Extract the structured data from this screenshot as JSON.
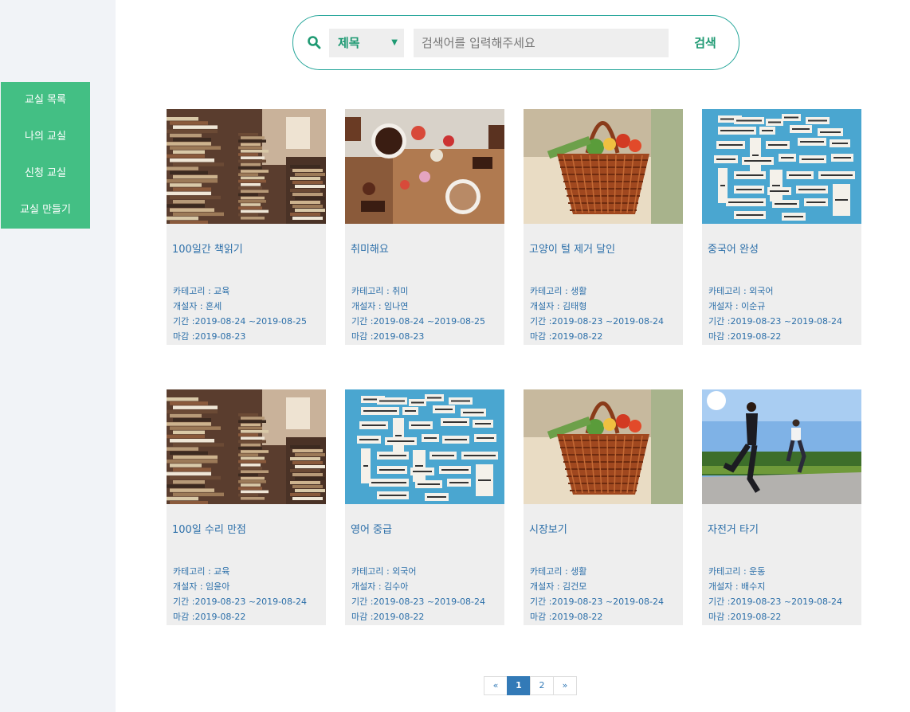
{
  "sidebar": {
    "items": [
      {
        "label": "교실 목록"
      },
      {
        "label": "나의 교실"
      },
      {
        "label": "신청 교실"
      },
      {
        "label": "교실 만들기"
      }
    ]
  },
  "search": {
    "select_value": "제목",
    "placeholder": "검색어를 입력해주세요",
    "button_label": "검색"
  },
  "cards": [
    {
      "title": "100일간 책읽기",
      "category": "카테고리 : 교육",
      "creator": "개설자 : 혼세",
      "period": "기간 :2019-08-24 ~2019-08-25",
      "deadline": "마감 :2019-08-23",
      "image": "books"
    },
    {
      "title": "취미해요",
      "category": "카테고리 : 취미",
      "creator": "개설자 : 임나연",
      "period": "기간 :2019-08-24 ~2019-08-25",
      "deadline": "마감 :2019-08-23",
      "image": "chocolate"
    },
    {
      "title": "고양이 털 제거 달인",
      "category": "카테고리 : 생활",
      "creator": "개설자 : 김태형",
      "period": "기간 :2019-08-23 ~2019-08-24",
      "deadline": "마감 :2019-08-22",
      "image": "basket"
    },
    {
      "title": "중국어 완성",
      "category": "카테고리 : 외국어",
      "creator": "개설자 : 이순규",
      "period": "기간 :2019-08-23 ~2019-08-24",
      "deadline": "마감 :2019-08-22",
      "image": "words"
    },
    {
      "title": "100일 수리 만점",
      "category": "카테고리 : 교육",
      "creator": "개설자 : 임윤아",
      "period": "기간 :2019-08-23 ~2019-08-24",
      "deadline": "마감 :2019-08-22",
      "image": "books"
    },
    {
      "title": "영어 중급",
      "category": "카테고리 : 외국어",
      "creator": "개설자 : 김수아",
      "period": "기간 :2019-08-23 ~2019-08-24",
      "deadline": "마감 :2019-08-22",
      "image": "words"
    },
    {
      "title": "시장보기",
      "category": "카테고리 : 생활",
      "creator": "개설자 : 김건모",
      "period": "기간 :2019-08-23 ~2019-08-24",
      "deadline": "마감 :2019-08-22",
      "image": "basket"
    },
    {
      "title": "자전거 타기",
      "category": "카테고리 : 운동",
      "creator": "개설자 : 배수지",
      "period": "기간 :2019-08-23 ~2019-08-24",
      "deadline": "마감 :2019-08-22",
      "image": "runners"
    }
  ],
  "pagination": {
    "prev": "«",
    "pages": [
      "1",
      "2"
    ],
    "active": "1",
    "next": "»"
  },
  "colors": {
    "accent_green": "#43bf84",
    "teal": "#26a69a",
    "link_blue": "#2c6fa9",
    "page_active": "#337ab7"
  }
}
